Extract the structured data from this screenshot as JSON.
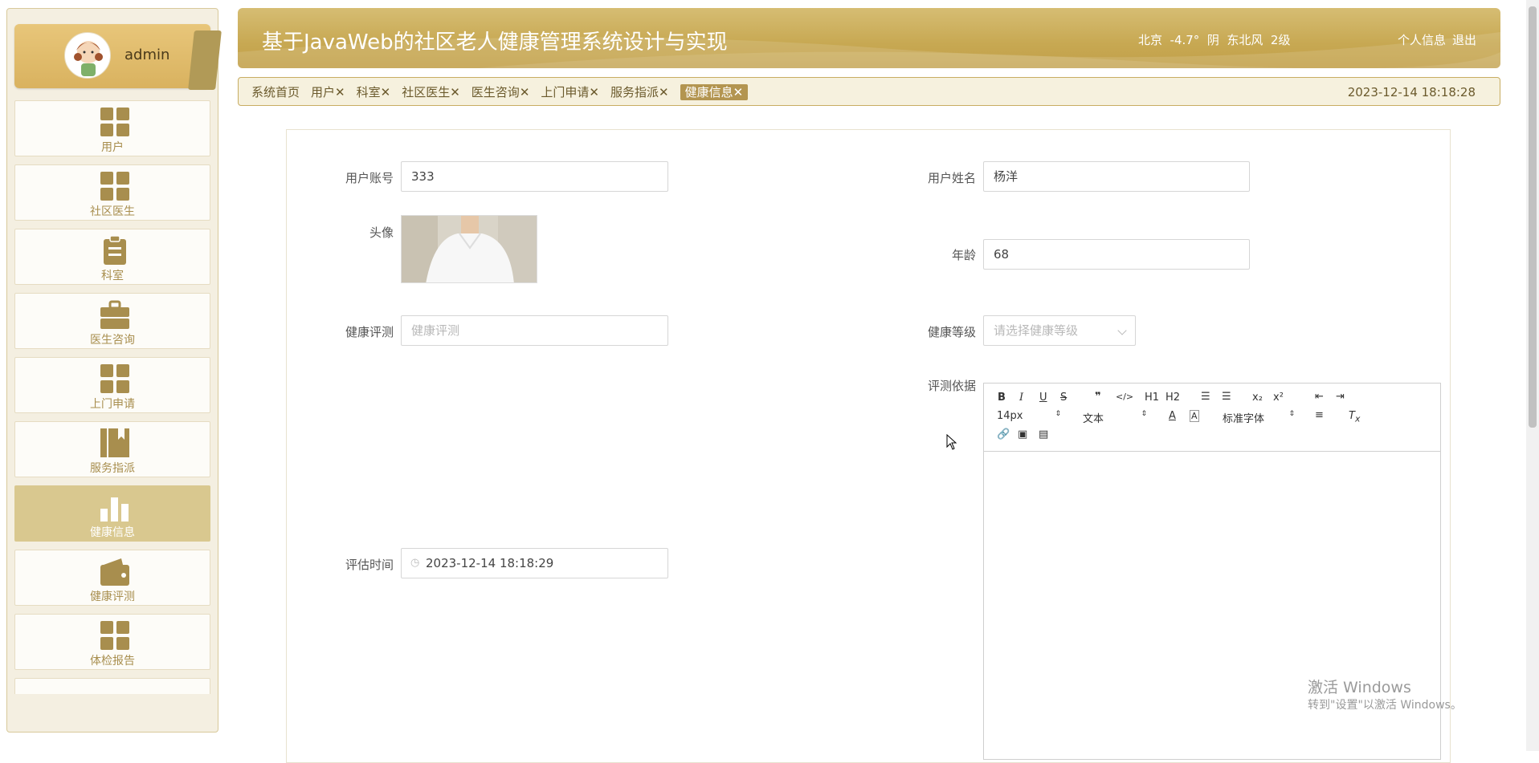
{
  "sidebar": {
    "username": "admin",
    "items": [
      {
        "label": "用户",
        "icon": "grid-icon",
        "active": false
      },
      {
        "label": "社区医生",
        "icon": "grid-icon",
        "active": false
      },
      {
        "label": "科室",
        "icon": "clipboard-icon",
        "active": false
      },
      {
        "label": "医生咨询",
        "icon": "briefcase-icon",
        "active": false
      },
      {
        "label": "上门申请",
        "icon": "grid-icon",
        "active": false
      },
      {
        "label": "服务指派",
        "icon": "book-icon",
        "active": false
      },
      {
        "label": "健康信息",
        "icon": "bar-chart-icon",
        "active": true
      },
      {
        "label": "健康评测",
        "icon": "wallet-icon",
        "active": false
      },
      {
        "label": "体检报告",
        "icon": "grid-icon",
        "active": false
      }
    ]
  },
  "header": {
    "title": "基于JavaWeb的社区老人健康管理系统设计与实现",
    "weather": "北京  -4.7°  阴  东北风  2级",
    "profile_link": "个人信息",
    "logout_link": "退出"
  },
  "tabs": {
    "items": [
      {
        "label": "系统首页",
        "closable": false
      },
      {
        "label": "用户",
        "closable": true
      },
      {
        "label": "科室",
        "closable": true
      },
      {
        "label": "社区医生",
        "closable": true
      },
      {
        "label": "医生咨询",
        "closable": true
      },
      {
        "label": "上门申请",
        "closable": true
      },
      {
        "label": "服务指派",
        "closable": true
      },
      {
        "label": "健康信息",
        "closable": true,
        "active": true
      }
    ],
    "datetime": "2023-12-14 18:18:28"
  },
  "form": {
    "account_label": "用户账号",
    "account_value": "333",
    "name_label": "用户姓名",
    "name_value": "杨洋",
    "avatar_label": "头像",
    "age_label": "年龄",
    "age_value": "68",
    "assessment_label": "健康评测",
    "assessment_placeholder": "健康评测",
    "level_label": "健康等级",
    "level_placeholder": "请选择健康等级",
    "basis_label": "评测依据",
    "time_label": "评估时间",
    "time_value": "2023-12-14 18:18:29"
  },
  "editor": {
    "font_size": "14px",
    "paragraph": "文本",
    "font_family": "标准字体",
    "buttons": {
      "h1": "H1",
      "h2": "H2",
      "sub": "x₂",
      "sup": "x²"
    }
  },
  "watermark": {
    "line1": "激活 Windows",
    "line2": "转到\"设置\"以激活 Windows。"
  },
  "colors": {
    "accent": "#c7a852",
    "active_menu": "#d9c88f",
    "menu_text": "#a88e4e"
  }
}
